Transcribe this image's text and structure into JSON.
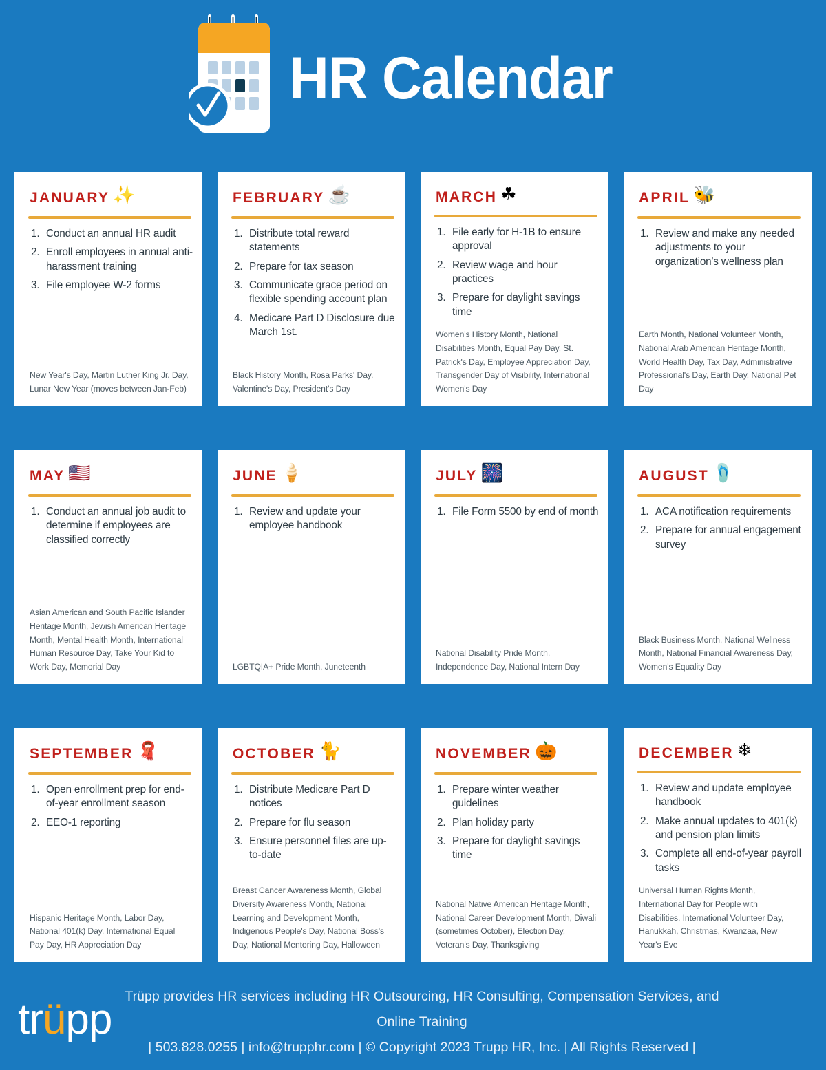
{
  "header": {
    "title": "HR Calendar",
    "icon_name": "calendar-check-icon",
    "icon_colors": {
      "band": "#F5A623",
      "body": "#FFFFFF",
      "day_cell": "#B9D0E4",
      "day_cell_highlight": "#0F3B52"
    }
  },
  "theme": {
    "background": "#1A7AC0",
    "card_background": "#FFFFFF",
    "month_heading": "#C0201C",
    "divider": "#E8A93A",
    "task_text": "#2E3B44",
    "holiday_text": "#4C5A63",
    "footer_text": "#E9F2FA",
    "logo_accent": "#F5A623"
  },
  "months": [
    {
      "name": "JANUARY",
      "icon": "hanging-stars-icon",
      "emoji": "✨",
      "tasks": [
        "Conduct an annual HR audit",
        "Enroll employees in annual anti-harassment training",
        "File employee W-2 forms"
      ],
      "holidays": "New Year's Day, Martin Luther King Jr. Day, Lunar New Year (moves between Jan-Feb)"
    },
    {
      "name": "FEBRUARY",
      "icon": "hot-cocoa-mug-icon",
      "emoji": "☕",
      "tasks": [
        "Distribute total reward statements",
        "Prepare for tax season",
        "Communicate grace period on flexible spending account plan",
        "Medicare Part D Disclosure due March 1st."
      ],
      "holidays": "Black History Month, Rosa Parks' Day, Valentine's Day, President's Day"
    },
    {
      "name": "MARCH",
      "icon": "shamrock-icon",
      "emoji": "☘",
      "tasks": [
        "File early for H-1B to ensure approval",
        "Review wage and hour practices",
        "Prepare for daylight savings time"
      ],
      "holidays": "Women's History Month, National Disabilities Month, Equal Pay Day, St. Patrick's Day, Employee Appreciation Day, Transgender Day of Visibility, International Women's Day"
    },
    {
      "name": "APRIL",
      "icon": "bee-icon",
      "emoji": "🐝",
      "tasks": [
        "Review and make any needed adjustments to your organization's wellness plan"
      ],
      "holidays": "Earth Month,  National Volunteer Month, National Arab American Heritage Month, World Health Day, Tax Day, Administrative Professional's Day, Earth Day, National Pet Day"
    },
    {
      "name": "MAY",
      "icon": "usa-flag-icon",
      "emoji": "🇺🇸",
      "tasks": [
        "Conduct an annual job audit to determine if employees are classified correctly"
      ],
      "holidays": "Asian American and South Pacific Islander Heritage Month, Jewish American Heritage Month, Mental Health Month, International Human Resource Day, Take Your Kid to Work Day, Memorial Day"
    },
    {
      "name": "JUNE",
      "icon": "popsicle-icon",
      "emoji": "🍦",
      "tasks": [
        "Review and update your employee handbook"
      ],
      "holidays": "LGBTQIA+ Pride Month, Juneteenth"
    },
    {
      "name": "JULY",
      "icon": "firework-icon",
      "emoji": "🎆",
      "tasks": [
        "File Form 5500 by end of month"
      ],
      "holidays": "National Disability Pride Month, Independence Day, National Intern Day"
    },
    {
      "name": "AUGUST",
      "icon": "flip-flops-icon",
      "emoji": "🩴",
      "tasks": [
        "ACA notification requirements",
        "Prepare for annual engagement survey"
      ],
      "holidays": "Black Business Month, National Wellness Month, National Financial Awareness Day, Women's Equality Day"
    },
    {
      "name": "SEPTEMBER",
      "icon": "sweater-icon",
      "emoji": "🧣",
      "tasks": [
        "Open enrollment prep for end-of-year enrollment season",
        "EEO-1 reporting"
      ],
      "holidays": "Hispanic Heritage Month, Labor Day, National 401(k) Day, International Equal Pay Day, HR Appreciation Day"
    },
    {
      "name": "OCTOBER",
      "icon": "black-cat-icon",
      "emoji": "🐈",
      "tasks": [
        "Distribute Medicare Part D notices",
        "Prepare for flu season",
        "Ensure personnel files are up-to-date"
      ],
      "holidays": "Breast Cancer Awareness Month, Global Diversity Awareness Month, National Learning and Development Month, Indigenous People's Day, National Boss's Day, National Mentoring Day, Halloween"
    },
    {
      "name": "NOVEMBER",
      "icon": "pumpkins-icon",
      "emoji": "🎃",
      "tasks": [
        "Prepare winter weather guidelines",
        "Plan holiday party",
        "Prepare for daylight savings time"
      ],
      "holidays": "National Native American Heritage Month, National Career Development Month, Diwali (sometimes October), Election Day, Veteran's Day, Thanksgiving"
    },
    {
      "name": "DECEMBER",
      "icon": "snowflakes-icon",
      "emoji": "❄",
      "tasks": [
        "Review and update employee handbook",
        "Make annual updates to 401(k) and pension plan limits",
        "Complete all end-of-year payroll tasks"
      ],
      "holidays": "Universal Human Rights Month, International Day for People with Disabilities, International Volunteer Day, Hanukkah, Christmas, Kwanzaa, New Year's Eve"
    }
  ],
  "footer": {
    "logo_prefix": "tr",
    "logo_accent": "ü",
    "logo_suffix": "pp",
    "line1": "Trüpp provides HR services including HR Outsourcing, HR Consulting, Compensation Services, and Online Training",
    "line2": "| 503.828.0255 | info@trupphr.com | © Copyright 2023 Trupp HR, Inc. | All Rights Reserved |"
  }
}
